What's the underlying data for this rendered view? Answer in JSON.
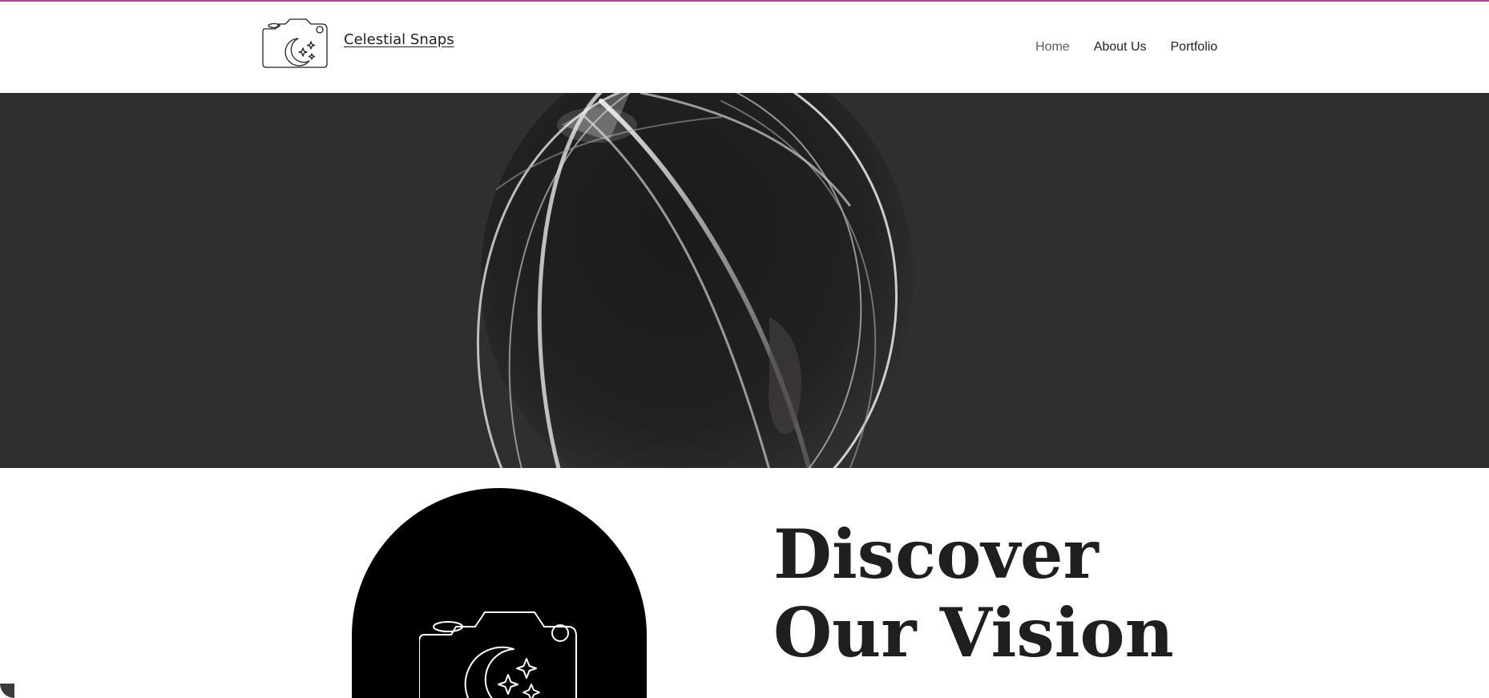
{
  "header": {
    "brand_name": "Celestial Snaps",
    "logo_icon": "camera-moon-stars-icon",
    "nav": [
      {
        "label": "Home",
        "active": true
      },
      {
        "label": "About Us",
        "active": false
      },
      {
        "label": "Portfolio",
        "active": false
      }
    ]
  },
  "hero": {
    "image_subject": "light-painting-orb"
  },
  "vision": {
    "headline_line1": "Discover",
    "headline_line2": "Our Vision",
    "badge_icon": "camera-moon-stars-icon"
  },
  "colors": {
    "accent_bar": "#b93a9b",
    "hero_bg": "#2f2f30",
    "arch_bg": "#000000",
    "text": "#1f1f1f"
  }
}
